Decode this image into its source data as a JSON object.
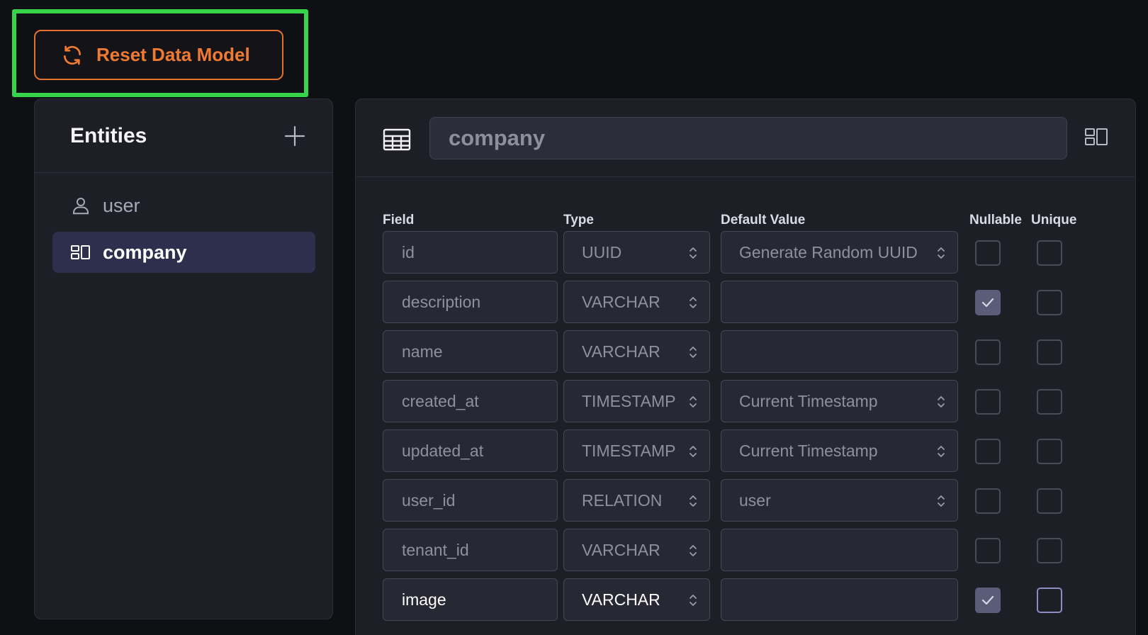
{
  "toolbar": {
    "reset_label": "Reset Data Model",
    "reset_icon": "refresh-icon",
    "accent_color": "#ef7a33",
    "highlight_color": "#37d34a"
  },
  "entities": {
    "title": "Entities",
    "add_icon": "plus-icon",
    "items": [
      {
        "label": "user",
        "icon": "user-icon",
        "selected": false
      },
      {
        "label": "company",
        "icon": "layout-icon",
        "selected": true
      }
    ]
  },
  "detail": {
    "entity_name": "company",
    "table_icon": "table-icon",
    "layout_icon": "layout-icon",
    "columns": {
      "field": "Field",
      "type": "Type",
      "default": "Default Value",
      "nullable": "Nullable",
      "unique": "Unique"
    },
    "rows": [
      {
        "field": "id",
        "type": "UUID",
        "default": "Generate Random UUID",
        "default_is_select": true,
        "nullable": false,
        "unique": false
      },
      {
        "field": "description",
        "type": "VARCHAR",
        "default": "",
        "default_is_select": false,
        "nullable": true,
        "unique": false
      },
      {
        "field": "name",
        "type": "VARCHAR",
        "default": "",
        "default_is_select": false,
        "nullable": false,
        "unique": false
      },
      {
        "field": "created_at",
        "type": "TIMESTAMP",
        "default": "Current Timestamp",
        "default_is_select": true,
        "nullable": false,
        "unique": false
      },
      {
        "field": "updated_at",
        "type": "TIMESTAMP",
        "default": "Current Timestamp",
        "default_is_select": true,
        "nullable": false,
        "unique": false
      },
      {
        "field": "user_id",
        "type": "RELATION",
        "default": "user",
        "default_is_select": true,
        "nullable": false,
        "unique": false
      },
      {
        "field": "tenant_id",
        "type": "VARCHAR",
        "default": "",
        "default_is_select": false,
        "nullable": false,
        "unique": false
      },
      {
        "field": "image",
        "type": "VARCHAR",
        "default": "",
        "default_is_select": false,
        "nullable": true,
        "unique": false,
        "active": true
      }
    ]
  }
}
